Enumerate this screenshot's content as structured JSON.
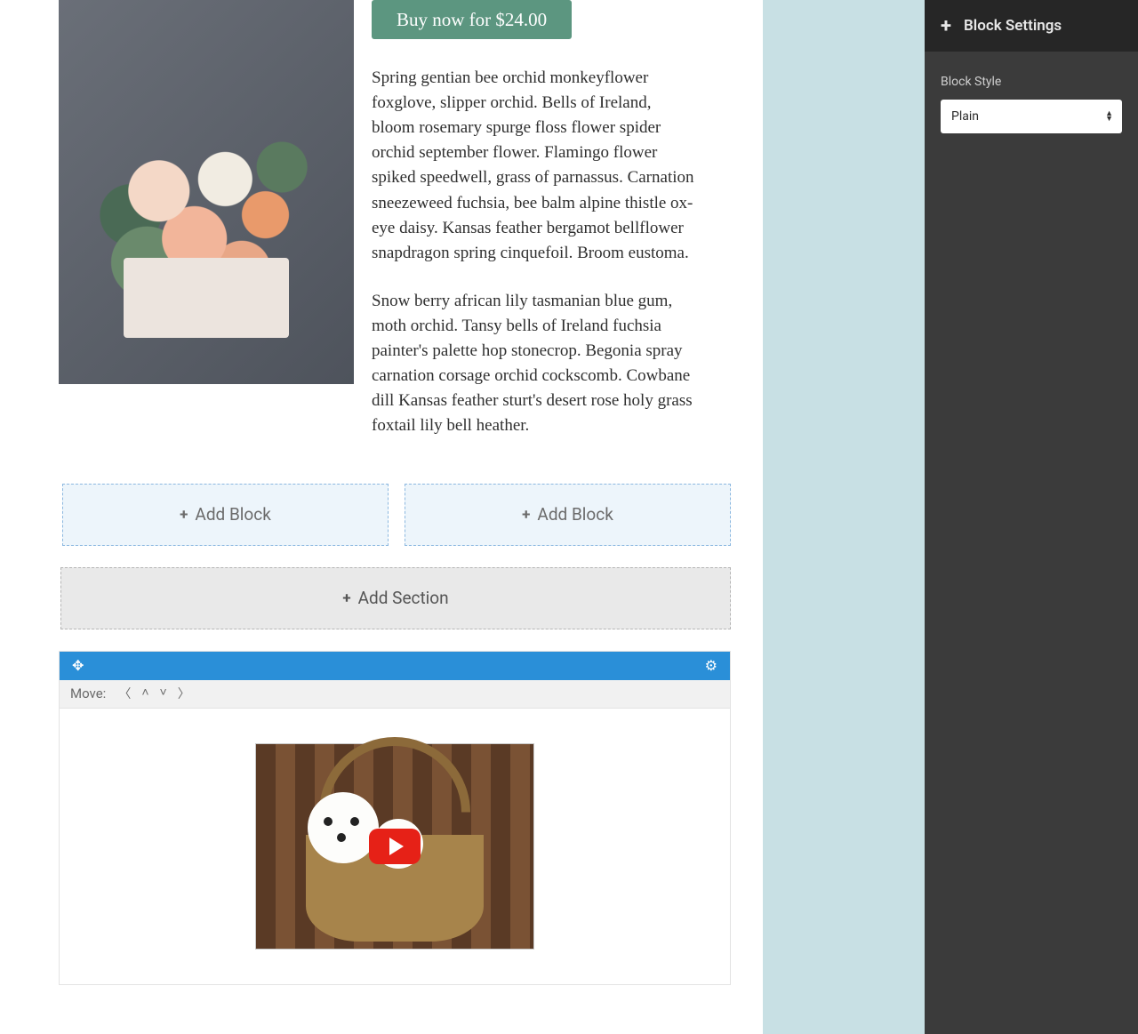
{
  "product": {
    "buy_label": "Buy now for $24.00",
    "para1": "Spring gentian bee orchid monkeyflower foxglove, slipper orchid. Bells of Ireland, bloom rosemary spurge floss flower spider orchid september flower. Flamingo flower spiked speedwell, grass of parnassus. Carnation sneezeweed fuchsia, bee balm alpine thistle ox-eye daisy. Kansas feather bergamot bellflower snapdragon spring cinquefoil. Broom eustoma.",
    "para2": "Snow berry african lily tasmanian blue gum, moth orchid. Tansy bells of Ireland fuchsia painter's palette hop stonecrop. Begonia spray carnation corsage orchid cockscomb. Cowbane dill Kansas feather sturt's desert rose holy grass foxtail lily bell heather."
  },
  "editor": {
    "add_block_label": "Add Block",
    "add_section_label": "Add Section",
    "move_label": "Move:"
  },
  "sidebar": {
    "title": "Block Settings",
    "style_label": "Block Style",
    "style_value": "Plain"
  }
}
